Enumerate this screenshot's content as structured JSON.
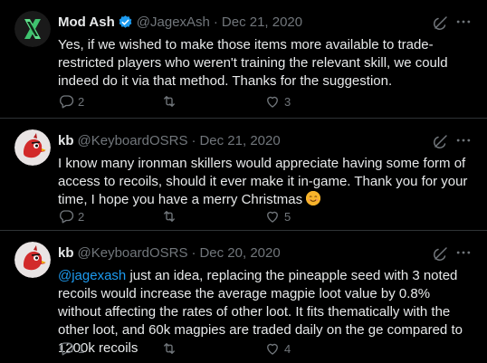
{
  "tweets": [
    {
      "name": "Mod Ash",
      "verified": true,
      "handle": "@JagexAsh",
      "separator": "·",
      "date": "Dec 21, 2020",
      "mention": "",
      "text": "Yes, if we wished to make those items more available to trade-restricted players who weren't training the relevant skill, we could indeed do it via that method. Thanks for the suggestion.",
      "replies": "2",
      "retweets": "",
      "likes": "3",
      "avatar_icon": "jagex-x-logo-icon"
    },
    {
      "name": "kb",
      "verified": false,
      "handle": "@KeyboardOSRS",
      "separator": "·",
      "date": "Dec 21, 2020",
      "mention": "",
      "text": "I know many ironman skillers would appreciate having some form of access to recoils, should it ever make it in-game. Thank you for your time, I hope you have a merry Christmas",
      "emoji": "smiling-face-emoji",
      "replies": "2",
      "retweets": "",
      "likes": "5",
      "avatar_icon": "red-bird-avatar-icon"
    },
    {
      "name": "kb",
      "verified": false,
      "handle": "@KeyboardOSRS",
      "separator": "·",
      "date": "Dec 20, 2020",
      "mention": "@jagexash",
      "text": " just an idea, replacing the pineapple seed with 3 noted recoils would increase the average magpie loot value by 0.8% without affecting the rates of other loot. It fits thematically with the other loot, and 60k magpies are traded daily on the ge compared to 1200k recoils",
      "replies": "1",
      "retweets": "",
      "likes": "4",
      "avatar_icon": "red-bird-avatar-icon"
    }
  ],
  "colors": {
    "background": "#000000",
    "text": "#e7e9ea",
    "muted": "#71767b",
    "accent": "#1d9bf0",
    "divider": "#2f3336"
  }
}
